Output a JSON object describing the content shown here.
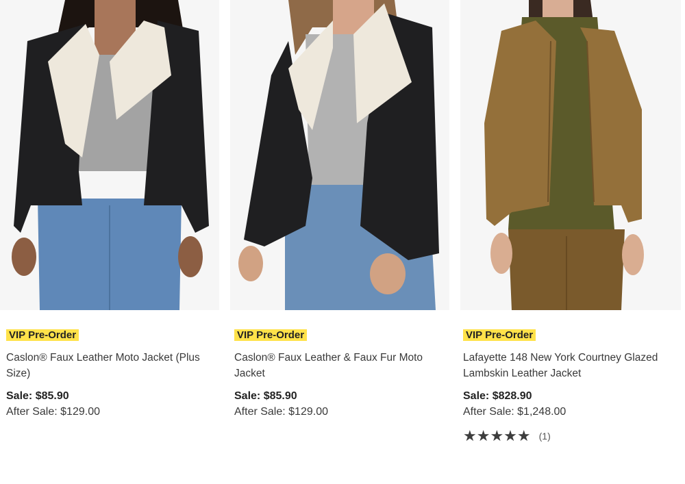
{
  "products": [
    {
      "badge": "VIP Pre-Order",
      "name": "Caslon® Faux Leather Moto Jacket (Plus Size)",
      "sale": "Sale: $85.90",
      "after_sale": "After Sale: $129.00",
      "image_icon": "jacket-photo"
    },
    {
      "badge": "VIP Pre-Order",
      "name": "Caslon® Faux Leather & Faux Fur Moto Jacket",
      "sale": "Sale: $85.90",
      "after_sale": "After Sale: $129.00",
      "image_icon": "jacket-photo"
    },
    {
      "badge": "VIP Pre-Order",
      "name": "Lafayette 148 New York Courtney Glazed Lambskin Leather Jacket",
      "sale": "Sale: $828.90",
      "after_sale": "After Sale: $1,248.00",
      "image_icon": "jacket-photo",
      "rating": {
        "stars": "★★★★★",
        "value": 5,
        "count": "(1)"
      }
    }
  ],
  "colors": {
    "badge_bg": "#ffe24a",
    "text": "#393939",
    "black_leather": "#1f1f21",
    "shearling": "#eee8dc",
    "tan_leather": "#94703a",
    "olive": "#5b5a2a",
    "denim": "#5f88b8"
  }
}
